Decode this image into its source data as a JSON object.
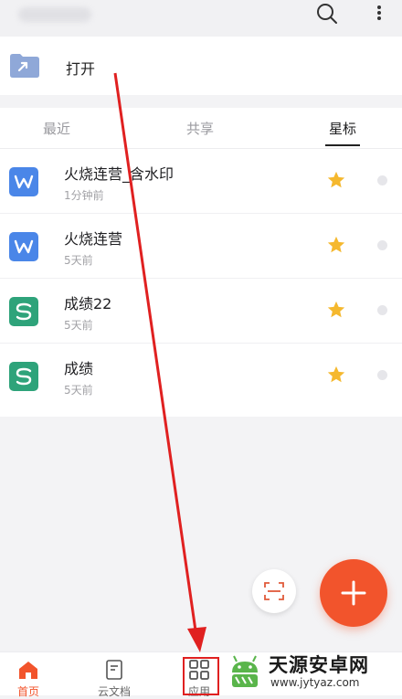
{
  "open_row": {
    "label": "打开"
  },
  "tabs": [
    {
      "label": "最近",
      "active": false
    },
    {
      "label": "共享",
      "active": false
    },
    {
      "label": "星标",
      "active": true
    }
  ],
  "files": [
    {
      "name": "火烧连营_含水印",
      "time": "1分钟前",
      "type": "writer",
      "icon": "W",
      "starred": true
    },
    {
      "name": "火烧连营",
      "time": "5天前",
      "type": "writer",
      "icon": "W",
      "starred": true
    },
    {
      "name": "成绩22",
      "time": "5天前",
      "type": "sheet",
      "icon": "S",
      "starred": true
    },
    {
      "name": "成绩",
      "time": "5天前",
      "type": "sheet",
      "icon": "S",
      "starred": true
    }
  ],
  "bottom_nav": [
    {
      "label": "首页",
      "icon": "home-icon",
      "active": true
    },
    {
      "label": "云文档",
      "icon": "document-icon",
      "active": false
    },
    {
      "label": "应用",
      "icon": "apps-grid-icon",
      "active": false
    }
  ],
  "watermark": {
    "title": "天源安卓网",
    "url": "www.jytyaz.com"
  },
  "colors": {
    "accent": "#f2542c",
    "writer_icon": "#4a86e8",
    "sheet_icon": "#2ea37a",
    "star": "#f5b82e",
    "annotation_red": "#e02020"
  }
}
